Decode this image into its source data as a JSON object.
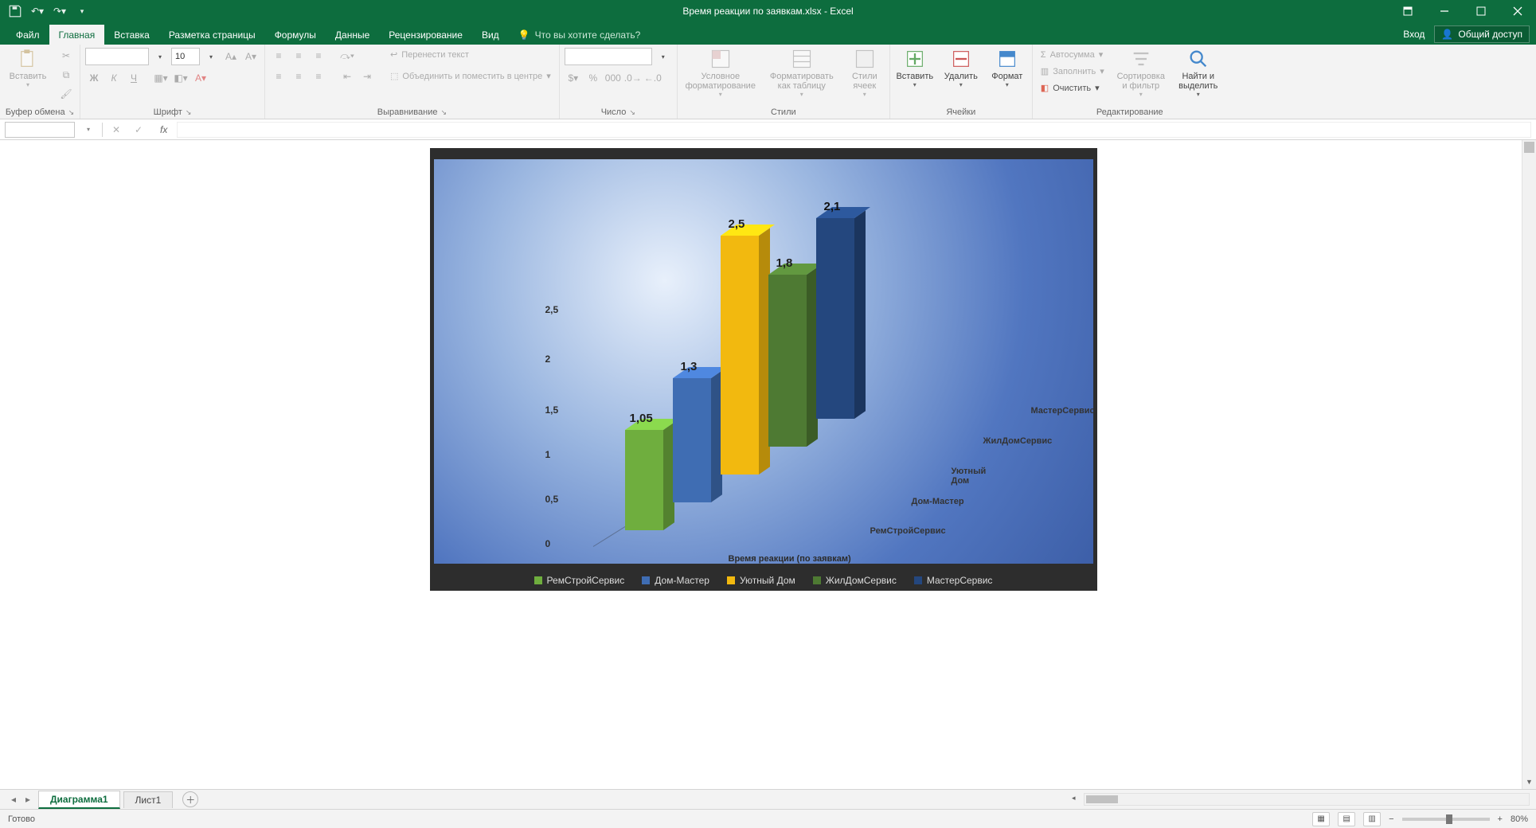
{
  "app": {
    "title": "Время реакции по заявкам.xlsx - Excel"
  },
  "tabs": {
    "file": "Файл",
    "list": [
      "Главная",
      "Вставка",
      "Разметка страницы",
      "Формулы",
      "Данные",
      "Рецензирование",
      "Вид"
    ],
    "tellme": "Что вы хотите сделать?",
    "signin": "Вход",
    "share": "Общий доступ"
  },
  "ribbon": {
    "clipboard": {
      "paste": "Вставить",
      "group": "Буфер обмена"
    },
    "font": {
      "group": "Шрифт",
      "size": "10",
      "bold": "Ж",
      "italic": "К",
      "underline": "Ч"
    },
    "align": {
      "group": "Выравнивание",
      "wrap": "Перенести текст",
      "merge": "Объединить и поместить в центре"
    },
    "number": {
      "group": "Число"
    },
    "styles": {
      "group": "Стили",
      "cond": "Условное форматирование",
      "table": "Форматировать как таблицу",
      "cell": "Стили ячеек"
    },
    "cells": {
      "group": "Ячейки",
      "insert": "Вставить",
      "delete": "Удалить",
      "format": "Формат"
    },
    "editing": {
      "group": "Редактирование",
      "sum": "Автосумма",
      "fill": "Заполнить",
      "clear": "Очистить",
      "sort": "Сортировка и фильтр",
      "find": "Найти и выделить"
    }
  },
  "formula": {
    "fx": "fx"
  },
  "sheets": {
    "active": "Диаграмма1",
    "other": "Лист1"
  },
  "status": {
    "ready": "Готово",
    "zoom": "80%"
  },
  "chart_legend_colors": {
    "РемСтройСервис": "#6fae3e",
    "Дом-Мастер": "#3f6db3",
    "Уютный Дом": "#f2b90f",
    "ЖилДомСервис": "#4e7a33",
    "МастерСервис": "#24477e"
  },
  "chart_data": {
    "type": "bar",
    "title": "",
    "xlabel": "Время реакции (по заявкам)",
    "ylabel": "",
    "ylim": [
      0,
      2.5
    ],
    "yticks": [
      0,
      0.5,
      1,
      1.5,
      2,
      2.5
    ],
    "ytick_labels": [
      "0",
      "0,5",
      "1",
      "1,5",
      "2",
      "2,5"
    ],
    "series": [
      {
        "name": "РемСтройСервис",
        "value": 1.05,
        "label": "1,05",
        "color": "#6fae3e"
      },
      {
        "name": "Дом-Мастер",
        "value": 1.3,
        "label": "1,3",
        "color": "#3f6db3"
      },
      {
        "name": "Уютный Дом",
        "value": 2.5,
        "label": "2,5",
        "color": "#f2b90f"
      },
      {
        "name": "ЖилДомСервис",
        "value": 1.8,
        "label": "1,8",
        "color": "#4e7a33"
      },
      {
        "name": "МастерСервис",
        "value": 2.1,
        "label": "2,1",
        "color": "#24477e"
      }
    ],
    "depth_axis_labels": [
      "РемСтройСервис",
      "Дом-Мастер",
      "Уютный Дом",
      "ЖилДомСервис",
      "МастерСервис"
    ]
  }
}
